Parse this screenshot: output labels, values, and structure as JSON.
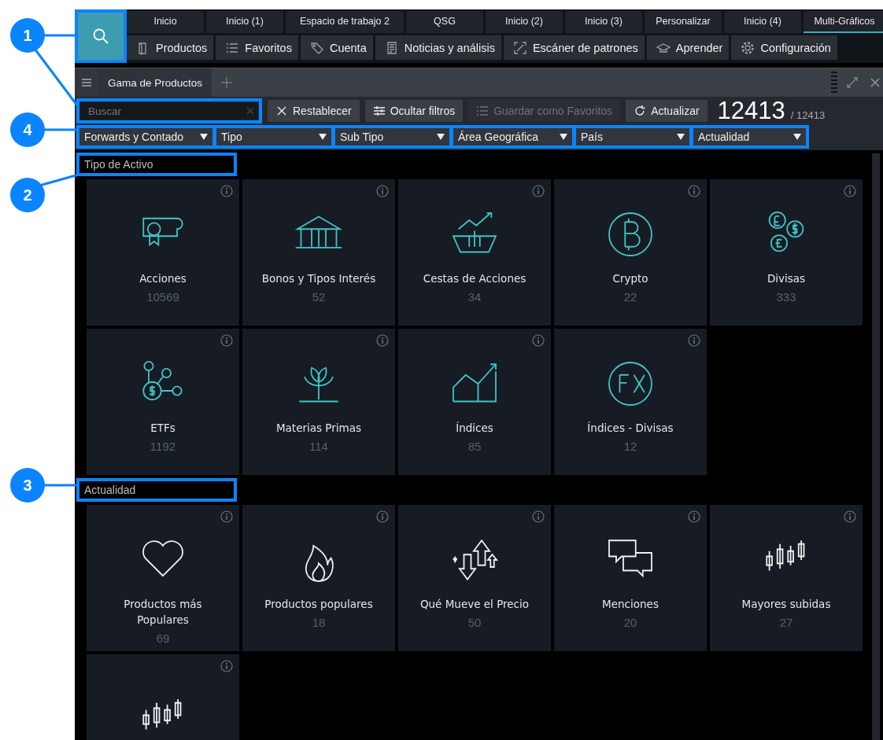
{
  "workspace_tabs": [
    {
      "label": "Inicio",
      "selected": false
    },
    {
      "label": "Inicio (1)",
      "selected": false
    },
    {
      "label": "Espacio de trabajo 2",
      "selected": false
    },
    {
      "label": "QSG",
      "selected": false
    },
    {
      "label": "Inicio (2)",
      "selected": false
    },
    {
      "label": "Inicio (3)",
      "selected": false
    },
    {
      "label": "Personalizar",
      "selected": false
    },
    {
      "label": "Inicio (4)",
      "selected": false
    },
    {
      "label": "Multi-Gráficos",
      "selected": true
    }
  ],
  "nav_menu": [
    "Productos",
    "Favoritos",
    "Cuenta",
    "Noticias y análisis",
    "Escáner de patrones",
    "Aprender",
    "Configuración"
  ],
  "panel": {
    "tab": "Gama de Productos"
  },
  "toolbar": {
    "search": {
      "placeholder": "Buscar"
    },
    "buttons": [
      {
        "label": "Restablecer",
        "disabled": false
      },
      {
        "label": "Ocultar filtros",
        "disabled": false
      },
      {
        "label": "Guardar como Favoritos",
        "disabled": true
      },
      {
        "label": "Actualizar",
        "disabled": false
      }
    ],
    "count": "12413",
    "total": "/ 12413"
  },
  "filters": [
    "Forwards y Contado",
    "Tipo",
    "Sub Tipo",
    "Área Geográfica",
    "País",
    "Actualidad"
  ],
  "sections": [
    {
      "title": "Tipo de Activo",
      "tiles": [
        {
          "name": "Acciones",
          "count": "10569"
        },
        {
          "name": "Bonos y Tipos Interés",
          "count": "52"
        },
        {
          "name": "Cestas de Acciones",
          "count": "34"
        },
        {
          "name": "Crypto",
          "count": "22"
        },
        {
          "name": "Divisas",
          "count": "333"
        },
        {
          "name": "ETFs",
          "count": "1192"
        },
        {
          "name": "Materias Primas",
          "count": "114"
        },
        {
          "name": "Índices",
          "count": "85"
        },
        {
          "name": "Índices - Divisas",
          "count": "12"
        }
      ]
    },
    {
      "title": "Actualidad",
      "tiles": [
        {
          "name": "Productos más Populares",
          "count": "69"
        },
        {
          "name": "Productos populares",
          "count": "18"
        },
        {
          "name": "Qué Mueve el Precio",
          "count": "50"
        },
        {
          "name": "Menciones",
          "count": "20"
        },
        {
          "name": "Mayores subidas",
          "count": "27"
        },
        {
          "kind": "icon_only"
        }
      ]
    }
  ],
  "callouts": [
    "1",
    "4",
    "2",
    "3"
  ]
}
